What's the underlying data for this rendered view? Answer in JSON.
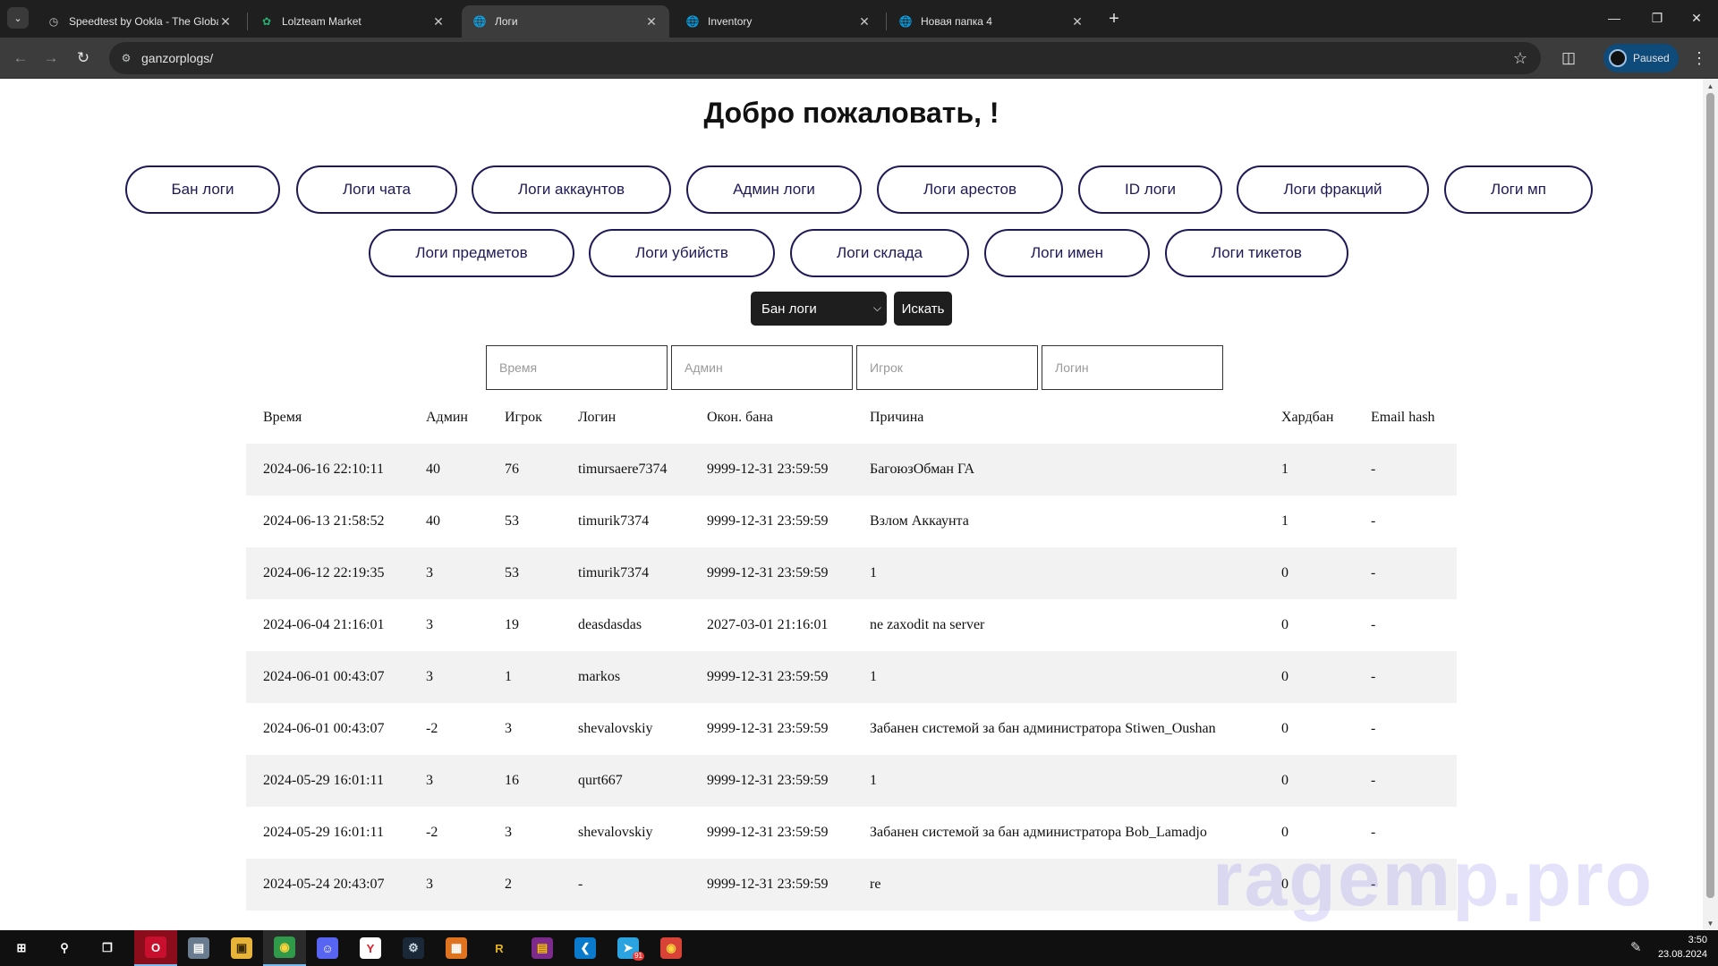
{
  "browser": {
    "tabs": [
      {
        "title": "Speedtest by Ookla - The Global",
        "favicon": "speedtest-icon",
        "active": false
      },
      {
        "title": "Lolzteam Market",
        "favicon": "lolzteam-icon",
        "active": false
      },
      {
        "title": "Логи",
        "favicon": "globe-icon",
        "active": true
      },
      {
        "title": "Inventory",
        "favicon": "globe-icon",
        "active": false
      },
      {
        "title": "Новая папка 4",
        "favicon": "globe-icon",
        "active": false
      }
    ],
    "url": "ganzorplogs/",
    "profile_status": "Paused"
  },
  "page": {
    "title": "Добро пожаловать, !",
    "nav_row1": [
      "Бан логи",
      "Логи чата",
      "Логи аккаунтов",
      "Админ логи",
      "Логи арестов",
      "ID логи",
      "Логи фракций",
      "Логи мп"
    ],
    "nav_row2": [
      "Логи предметов",
      "Логи убийств",
      "Логи склада",
      "Логи имен",
      "Логи тикетов"
    ],
    "log_type_select": {
      "selected": "Бан логи"
    },
    "search_button": "Искать",
    "filters": {
      "time_placeholder": "Время",
      "admin_placeholder": "Админ",
      "player_placeholder": "Игрок",
      "login_placeholder": "Логин"
    },
    "table": {
      "columns": [
        "Время",
        "Админ",
        "Игрок",
        "Логин",
        "Окон. бана",
        "Причина",
        "Хардбан",
        "Email hash"
      ],
      "rows": [
        [
          "2024-06-16 22:10:11",
          "40",
          "76",
          "timursaere7374",
          "9999-12-31 23:59:59",
          "БагоюзОбман ГА",
          "1",
          "-"
        ],
        [
          "2024-06-13 21:58:52",
          "40",
          "53",
          "timurik7374",
          "9999-12-31 23:59:59",
          "Взлом Аккаунта",
          "1",
          "-"
        ],
        [
          "2024-06-12 22:19:35",
          "3",
          "53",
          "timurik7374",
          "9999-12-31 23:59:59",
          "1",
          "0",
          "-"
        ],
        [
          "2024-06-04 21:16:01",
          "3",
          "19",
          "deasdasdas",
          "2027-03-01 21:16:01",
          "ne zaxodit na server",
          "0",
          "-"
        ],
        [
          "2024-06-01 00:43:07",
          "3",
          "1",
          "markos",
          "9999-12-31 23:59:59",
          "1",
          "0",
          "-"
        ],
        [
          "2024-06-01 00:43:07",
          "-2",
          "3",
          "shevalovskiy",
          "9999-12-31 23:59:59",
          "Забанен системой за бан администратора Stiwen_Oushan",
          "0",
          "-"
        ],
        [
          "2024-05-29 16:01:11",
          "3",
          "16",
          "qurt667",
          "9999-12-31 23:59:59",
          "1",
          "0",
          "-"
        ],
        [
          "2024-05-29 16:01:11",
          "-2",
          "3",
          "shevalovskiy",
          "9999-12-31 23:59:59",
          "Забанен системой за бан администратора Bob_Lamadjo",
          "0",
          "-"
        ],
        [
          "2024-05-24 20:43:07",
          "3",
          "2",
          "-",
          "9999-12-31 23:59:59",
          "re",
          "0",
          "-"
        ]
      ]
    },
    "watermark": "ragemp.pro"
  },
  "taskbar": {
    "apps": [
      "windows-start-icon",
      "search-icon",
      "task-view-icon",
      "opera-icon",
      "folder-app-icon",
      "file-explorer-icon",
      "chrome-icon",
      "discord-icon",
      "yandex-browser-icon",
      "steam-icon",
      "app-x-icon",
      "rage-icon",
      "winrar-icon",
      "vscode-icon",
      "telegram-icon",
      "chrome-icon-2"
    ],
    "telegram_badge": "91",
    "time": "3:50",
    "date": "23.08.2024"
  },
  "colors": {
    "accent": "#1e1a57",
    "row_shade": "#f2f2f2",
    "chrome_dark": "#1f1f1f",
    "toolbar": "#3c3c3c",
    "profile": "#0e4a7a"
  }
}
